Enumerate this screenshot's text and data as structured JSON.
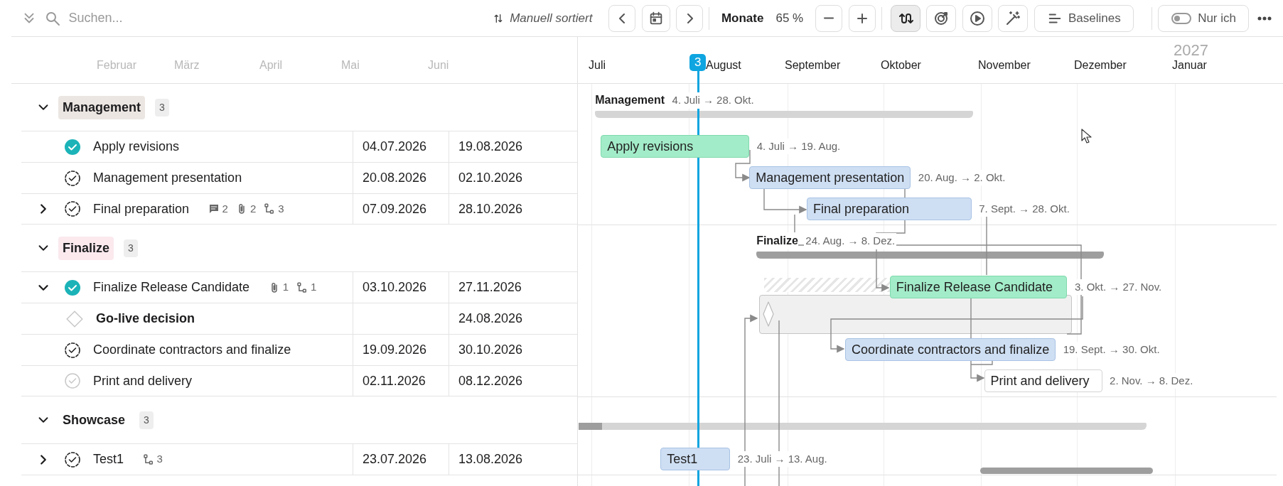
{
  "toolbar": {
    "search": {
      "placeholder": "Suchen..."
    },
    "sort_label": "Manuell sortiert",
    "zoom_unit": "Monate",
    "zoom_level": "65 %",
    "tools": [
      {
        "kind": "dependencies",
        "selected": true
      },
      {
        "kind": "target",
        "selected": false
      },
      {
        "kind": "play",
        "selected": false
      },
      {
        "kind": "magic",
        "selected": false
      }
    ],
    "baselines_label": "Baselines",
    "filter": {
      "label": "Nur ich",
      "on": false
    }
  },
  "timeline": {
    "year": "2027",
    "left_months": [
      "Februar",
      "März",
      "April",
      "Mai",
      "Juni"
    ],
    "months": [
      "Juli",
      "August",
      "September",
      "Oktober",
      "November",
      "Dezember",
      "Januar"
    ],
    "today": "3"
  },
  "groups": [
    {
      "name": "Management",
      "count": "3",
      "expanded": true,
      "color": "#ece6e2",
      "summary_label": "Management",
      "range": "4. Juli → 28. Okt.",
      "tasks": [
        {
          "kind": "task",
          "done": true,
          "name": "Apply revisions",
          "start": "04.07.2026",
          "end": "19.08.2026",
          "bar_label": "Apply revisions",
          "range": "4. Juli → 19. Aug."
        },
        {
          "kind": "task",
          "done": false,
          "started": true,
          "name": "Management presentation",
          "start": "20.08.2026",
          "end": "02.10.2026",
          "bar_label": "Management presentation",
          "range": "20. Aug. → 2. Okt."
        },
        {
          "kind": "task",
          "done": false,
          "started": true,
          "name": "Final preparation",
          "expanded": false,
          "meta": {
            "comments": "2",
            "attachments": "2",
            "subtasks": "3"
          },
          "start": "07.09.2026",
          "end": "28.10.2026",
          "bar_label": "Final preparation",
          "range": "7. Sept. → 28. Okt."
        }
      ]
    },
    {
      "name": "Finalize",
      "count": "3",
      "expanded": true,
      "color": "#fbe9ee",
      "summary_label": "Finalize",
      "range": "24. Aug. → 8. Dez.",
      "tasks": [
        {
          "kind": "task",
          "done": true,
          "name": "Finalize Release Candidate",
          "expanded": true,
          "meta": {
            "attachments": "1",
            "subtasks": "1"
          },
          "start": "03.10.2026",
          "end": "27.11.2026",
          "bar_label": "Finalize Release Candidate",
          "range": "3. Okt. → 27. Nov."
        },
        {
          "kind": "milestone",
          "name": "Go-live decision",
          "end": "24.08.2026"
        },
        {
          "kind": "task",
          "done": false,
          "started": true,
          "name": "Coordinate contractors and finalize",
          "start": "19.09.2026",
          "end": "30.10.2026",
          "bar_label": "Coordinate contractors and finalize",
          "range": "19. Sept. → 30. Okt."
        },
        {
          "kind": "task",
          "done": false,
          "started": false,
          "name": "Print and delivery",
          "start": "02.11.2026",
          "end": "08.12.2026",
          "bar_label": "Print and delivery",
          "range": "2. Nov. → 8. Dez."
        }
      ]
    },
    {
      "name": "Showcase",
      "count": "3",
      "expanded": true,
      "tasks": [
        {
          "kind": "task",
          "done": false,
          "started": true,
          "name": "Test1",
          "expanded": false,
          "meta": {
            "subtasks": "3"
          },
          "start": "23.07.2026",
          "end": "13.08.2026",
          "bar_label": "Test1",
          "range": "23. Juli → 13. Aug."
        }
      ]
    }
  ]
}
